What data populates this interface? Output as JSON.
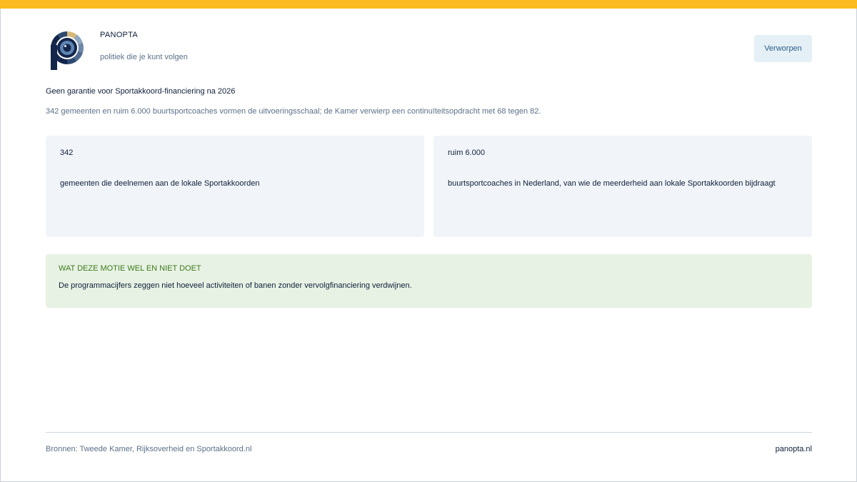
{
  "brand": {
    "name": "PANOPTA",
    "tagline": "politiek die je kunt volgen",
    "logo_icon": "panopta-eye-logo-icon"
  },
  "status": {
    "label": "Verworpen"
  },
  "headline": "Geen garantie voor Sportakkoord-financiering na 2026",
  "subheadline": "342 gemeenten en ruim 6.000 buurtsportcoaches vormen de uitvoeringsschaal; de Kamer verwierp een continuïteitsopdracht met 68 tegen 82.",
  "stats": [
    {
      "value": "342",
      "description": "gemeenten die deelnemen aan de lokale Sportakkoorden"
    },
    {
      "value": "ruim 6.000",
      "description": "buurtsportcoaches in Nederland, van wie de meerderheid aan lokale Sportakkoorden bijdraagt"
    }
  ],
  "notice": {
    "title": "WAT DEZE MOTIE WEL EN NIET DOET",
    "body": "De programmacijfers zeggen niet hoeveel activiteiten of banen zonder vervolgfinanciering verdwijnen."
  },
  "footer": {
    "sources": "Bronnen: Tweede Kamer, Rijksoverheid en Sportakkoord.nl",
    "site": "panopta.nl"
  },
  "colors": {
    "accent_bar": "#fbba1f",
    "navy": "#0f1f3a",
    "muted_text": "#5c7089",
    "card_bg": "#f1f4f8",
    "notice_bg": "#e7f2e4",
    "notice_title": "#3d7a1a",
    "status_bg": "#e4eff6",
    "status_text": "#2a5f86"
  }
}
